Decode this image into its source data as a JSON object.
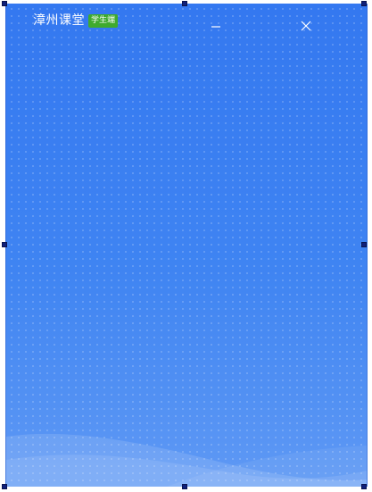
{
  "window": {
    "title": "漳州课堂",
    "badge": "学生端"
  },
  "colors": {
    "background_top": "#3478f0",
    "background_bottom": "#5f99f4",
    "badge": "#3faa2e",
    "handle": "#10207a"
  },
  "controls": {
    "minimize_icon": "minimize-icon",
    "close_icon": "close-icon"
  }
}
